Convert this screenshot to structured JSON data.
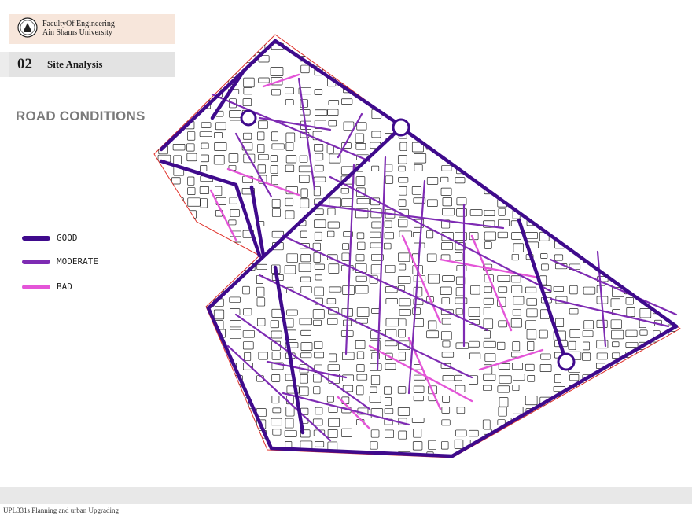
{
  "header": {
    "faculty_line1": "FacultyOf Engineering",
    "faculty_line2": "Ain Shams University",
    "logo_icon": "university-seal-icon"
  },
  "section": {
    "number": "02",
    "title": "Site Analysis"
  },
  "page_title": "ROAD CONDITIONS",
  "legend": [
    {
      "label": "GOOD",
      "color": "#3f0a8c"
    },
    {
      "label": "MODERATE",
      "color": "#7e2bb3"
    },
    {
      "label": "BAD",
      "color": "#e455d8"
    }
  ],
  "map": {
    "boundary_color": "#e0322b",
    "block_outline_color": "#222222"
  },
  "footer": {
    "text": "UPL331s Planning and urban Upgrading"
  }
}
